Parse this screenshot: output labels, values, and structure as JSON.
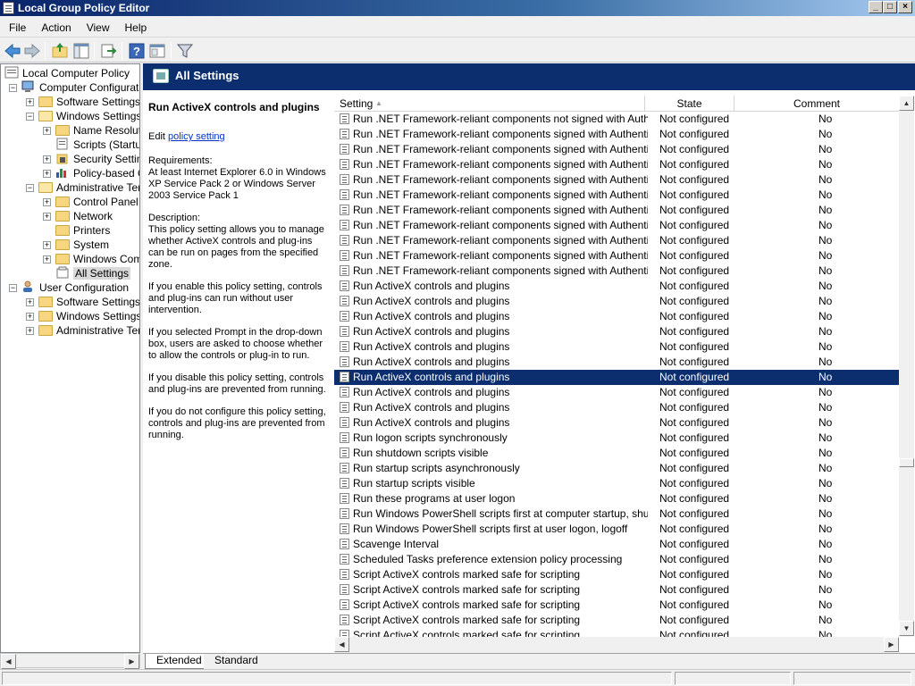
{
  "window": {
    "title": "Local Group Policy Editor",
    "min_label": "_",
    "max_label": "□",
    "close_label": "×"
  },
  "menu": [
    "File",
    "Action",
    "View",
    "Help"
  ],
  "toolbar": [
    "back-icon",
    "forward-icon",
    "up-folder-icon",
    "show-hide-tree-icon",
    "export-list-icon",
    "help-icon",
    "properties-icon",
    "filter-icon"
  ],
  "tree": {
    "root": "Local Computer Policy",
    "computer": "Computer Configuration",
    "c_software": "Software Settings",
    "c_windows": "Windows Settings",
    "name_res": "Name Resolutic",
    "scripts": "Scripts (Startup",
    "security": "Security Setting",
    "policy_qos": "Policy-based Q",
    "c_admin": "Administrative Temp",
    "control_panel": "Control Panel",
    "network": "Network",
    "printers": "Printers",
    "system": "System",
    "windows_comp": "Windows Comp",
    "all_settings": "All Settings",
    "user": "User Configuration",
    "u_software": "Software Settings",
    "u_windows": "Windows Settings",
    "u_admin": "Administrative Temp"
  },
  "header": {
    "title": "All Settings"
  },
  "description": {
    "title": "Run ActiveX controls and plugins",
    "edit_prefix": "Edit",
    "edit_link": "policy setting",
    "requirements_label": "Requirements:",
    "requirements": "At least Internet Explorer 6.0 in Windows XP Service Pack 2 or Windows Server 2003 Service Pack 1",
    "description_label": "Description:",
    "p1": "This policy setting allows you to manage whether ActiveX controls and plug-ins can be run on pages from the specified zone.",
    "p2": "If you enable this policy setting, controls and plug-ins can run without user intervention.",
    "p3": "If you selected Prompt in the drop-down box, users are asked to choose whether to allow the controls or plug-in to run.",
    "p4": "If you disable this policy setting, controls and plug-ins are prevented from running.",
    "p5": "If you do not configure this policy setting, controls and plug-ins are prevented from running."
  },
  "list": {
    "columns": {
      "setting": "Setting",
      "state": "State",
      "comment": "Comment"
    },
    "sort_glyph": "▲",
    "selected_index": 17,
    "rows": [
      {
        "setting": "Run .NET Framework-reliant components not signed with Authentic...",
        "state": "Not configured",
        "comment": "No"
      },
      {
        "setting": "Run .NET Framework-reliant components signed with Authenticode",
        "state": "Not configured",
        "comment": "No"
      },
      {
        "setting": "Run .NET Framework-reliant components signed with Authenticode",
        "state": "Not configured",
        "comment": "No"
      },
      {
        "setting": "Run .NET Framework-reliant components signed with Authenticode",
        "state": "Not configured",
        "comment": "No"
      },
      {
        "setting": "Run .NET Framework-reliant components signed with Authenticode",
        "state": "Not configured",
        "comment": "No"
      },
      {
        "setting": "Run .NET Framework-reliant components signed with Authenticode",
        "state": "Not configured",
        "comment": "No"
      },
      {
        "setting": "Run .NET Framework-reliant components signed with Authenticode",
        "state": "Not configured",
        "comment": "No"
      },
      {
        "setting": "Run .NET Framework-reliant components signed with Authenticode",
        "state": "Not configured",
        "comment": "No"
      },
      {
        "setting": "Run .NET Framework-reliant components signed with Authenticode",
        "state": "Not configured",
        "comment": "No"
      },
      {
        "setting": "Run .NET Framework-reliant components signed with Authenticode",
        "state": "Not configured",
        "comment": "No"
      },
      {
        "setting": "Run .NET Framework-reliant components signed with Authenticode",
        "state": "Not configured",
        "comment": "No"
      },
      {
        "setting": "Run ActiveX controls and plugins",
        "state": "Not configured",
        "comment": "No"
      },
      {
        "setting": "Run ActiveX controls and plugins",
        "state": "Not configured",
        "comment": "No"
      },
      {
        "setting": "Run ActiveX controls and plugins",
        "state": "Not configured",
        "comment": "No"
      },
      {
        "setting": "Run ActiveX controls and plugins",
        "state": "Not configured",
        "comment": "No"
      },
      {
        "setting": "Run ActiveX controls and plugins",
        "state": "Not configured",
        "comment": "No"
      },
      {
        "setting": "Run ActiveX controls and plugins",
        "state": "Not configured",
        "comment": "No"
      },
      {
        "setting": "Run ActiveX controls and plugins",
        "state": "Not configured",
        "comment": "No"
      },
      {
        "setting": "Run ActiveX controls and plugins",
        "state": "Not configured",
        "comment": "No"
      },
      {
        "setting": "Run ActiveX controls and plugins",
        "state": "Not configured",
        "comment": "No"
      },
      {
        "setting": "Run ActiveX controls and plugins",
        "state": "Not configured",
        "comment": "No"
      },
      {
        "setting": "Run logon scripts synchronously",
        "state": "Not configured",
        "comment": "No"
      },
      {
        "setting": "Run shutdown scripts visible",
        "state": "Not configured",
        "comment": "No"
      },
      {
        "setting": "Run startup scripts asynchronously",
        "state": "Not configured",
        "comment": "No"
      },
      {
        "setting": "Run startup scripts visible",
        "state": "Not configured",
        "comment": "No"
      },
      {
        "setting": "Run these programs at user logon",
        "state": "Not configured",
        "comment": "No"
      },
      {
        "setting": "Run Windows PowerShell scripts first at computer startup, shutdown",
        "state": "Not configured",
        "comment": "No"
      },
      {
        "setting": "Run Windows PowerShell scripts first at user logon, logoff",
        "state": "Not configured",
        "comment": "No"
      },
      {
        "setting": "Scavenge Interval",
        "state": "Not configured",
        "comment": "No"
      },
      {
        "setting": "Scheduled Tasks preference extension policy processing",
        "state": "Not configured",
        "comment": "No"
      },
      {
        "setting": "Script ActiveX controls marked safe for scripting",
        "state": "Not configured",
        "comment": "No"
      },
      {
        "setting": "Script ActiveX controls marked safe for scripting",
        "state": "Not configured",
        "comment": "No"
      },
      {
        "setting": "Script ActiveX controls marked safe for scripting",
        "state": "Not configured",
        "comment": "No"
      },
      {
        "setting": "Script ActiveX controls marked safe for scripting",
        "state": "Not configured",
        "comment": "No"
      },
      {
        "setting": "Script ActiveX controls marked safe for scripting",
        "state": "Not configured",
        "comment": "No"
      }
    ]
  },
  "tabs": {
    "extended": "Extended",
    "standard": "Standard"
  },
  "colors": {
    "header_bg": "#0c2e6f",
    "selection_bg": "#0c2e6f",
    "link": "#0033cc"
  }
}
